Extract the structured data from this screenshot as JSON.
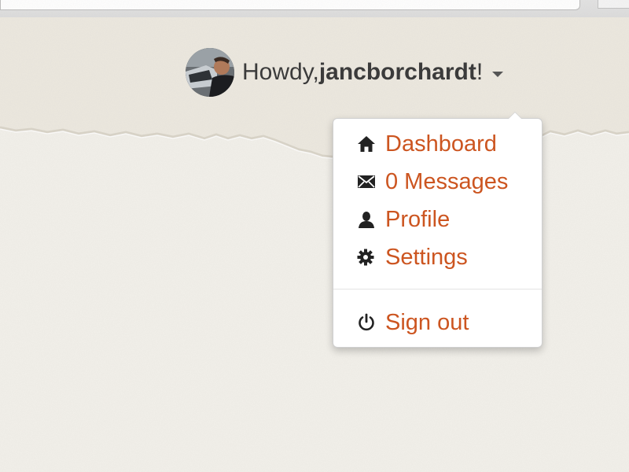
{
  "header": {
    "greeting_prefix": "Howdy, ",
    "username": "jancborchardt",
    "greeting_suffix": "!"
  },
  "user_menu": {
    "items": [
      {
        "label": "Dashboard",
        "icon": "home-icon"
      },
      {
        "label": "0 Messages",
        "icon": "envelope-icon"
      },
      {
        "label": "Profile",
        "icon": "user-icon"
      },
      {
        "label": "Settings",
        "icon": "gear-icon"
      }
    ],
    "sign_out": {
      "label": "Sign out",
      "icon": "power-icon"
    }
  },
  "colors": {
    "link": "#cc5520",
    "text": "#3b3b3b",
    "paper": "#f2f0ea"
  }
}
